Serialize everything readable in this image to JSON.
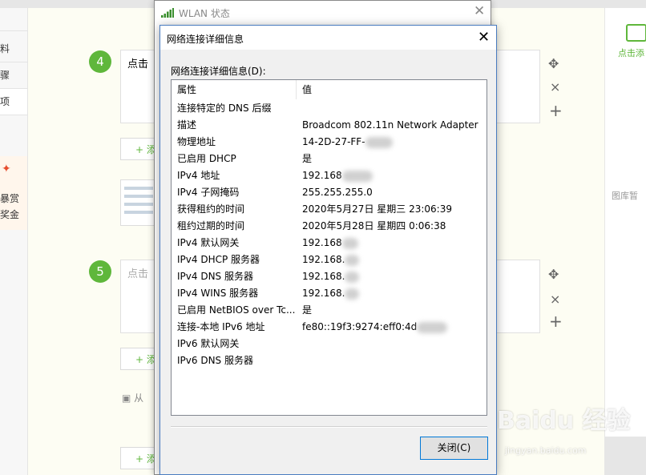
{
  "background_page": {
    "nav_items": [
      "料",
      "骤",
      "项"
    ],
    "reward": {
      "line1": "暴赏",
      "line2": "奖金"
    },
    "steps": [
      {
        "number": "4",
        "placeholder": "点击"
      },
      {
        "number": "5",
        "placeholder": "点击"
      }
    ],
    "add_label": "+ 添",
    "from_gallery": "从",
    "right_panel": {
      "add_label": "点击添",
      "empty_text": "图库暂"
    },
    "tools": {
      "move": "✥",
      "delete": "×",
      "add": "+"
    }
  },
  "wlan_window": {
    "title": "WLAN 状态",
    "close_symbol": "✕"
  },
  "details_dialog": {
    "title": "网络连接详细信息",
    "close_symbol": "✕",
    "section_label": "网络连接详细信息(D):",
    "columns": {
      "property": "属性",
      "value": "值"
    },
    "rows": [
      {
        "property": "连接特定的 DNS 后缀",
        "value": ""
      },
      {
        "property": "描述",
        "value": "Broadcom 802.11n Network Adapter"
      },
      {
        "property": "物理地址",
        "value": "14-2D-27-FF-"
      },
      {
        "property": "已启用 DHCP",
        "value": "是"
      },
      {
        "property": "IPv4 地址",
        "value": "192.168"
      },
      {
        "property": "IPv4 子网掩码",
        "value": "255.255.255.0"
      },
      {
        "property": "获得租约的时间",
        "value": "2020年5月27日 星期三 23:06:39"
      },
      {
        "property": "租约过期的时间",
        "value": "2020年5月28日 星期四 0:06:38"
      },
      {
        "property": "IPv4 默认网关",
        "value": "192.168"
      },
      {
        "property": "IPv4 DHCP 服务器",
        "value": "192.168."
      },
      {
        "property": "IPv4 DNS 服务器",
        "value": "192.168."
      },
      {
        "property": "IPv4 WINS 服务器",
        "value": "192.168."
      },
      {
        "property": "已启用 NetBIOS over Tc...",
        "value": "是"
      },
      {
        "property": "连接-本地 IPv6 地址",
        "value": "fe80::19f3:9274:eff0:4d"
      },
      {
        "property": "IPv6 默认网关",
        "value": ""
      },
      {
        "property": "IPv6 DNS 服务器",
        "value": ""
      }
    ],
    "close_button": "关闭(C)"
  },
  "watermark": {
    "brand": "Baidu 经验",
    "url": "jingyan.baidu.com"
  },
  "colors": {
    "accent_green": "#5fb73b",
    "dialog_border": "#4a7cc0",
    "button_focus": "#0078d7"
  }
}
